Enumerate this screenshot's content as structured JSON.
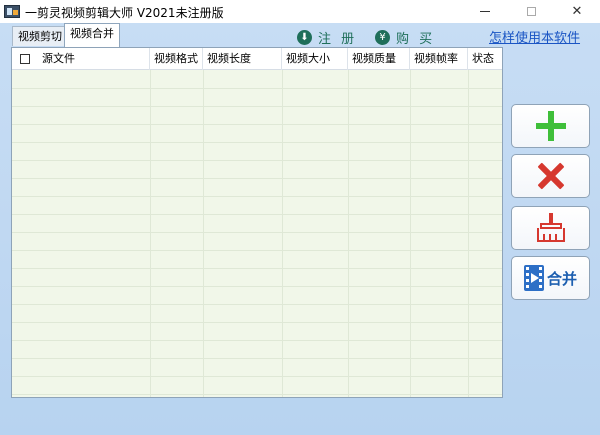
{
  "window": {
    "title": "一剪灵视频剪辑大师 V2021未注册版"
  },
  "tabs": [
    {
      "label": "视频剪切"
    },
    {
      "label": "视频合并"
    }
  ],
  "toolbar": {
    "register_label": "注 册",
    "buy_label": "购 买",
    "help_link": "怎样使用本软件"
  },
  "table": {
    "columns": [
      "源文件",
      "视频格式",
      "视频长度",
      "视频大小",
      "视频质量",
      "视频帧率",
      "状态"
    ]
  },
  "side_buttons": {
    "merge_label": "合并"
  },
  "icons": {
    "add": "plus-icon",
    "delete": "x-icon",
    "clear": "broom-icon",
    "merge": "film-icon",
    "register": "download-arrow-icon",
    "buy": "yuan-icon"
  },
  "colors": {
    "accent_green": "#3fbf3a",
    "accent_red": "#d6382f",
    "link_blue": "#1a55c4",
    "toolbar_text": "#1f6f5a",
    "grid_bg": "#f1f7e9",
    "client_bg": "#c0d8f2"
  }
}
